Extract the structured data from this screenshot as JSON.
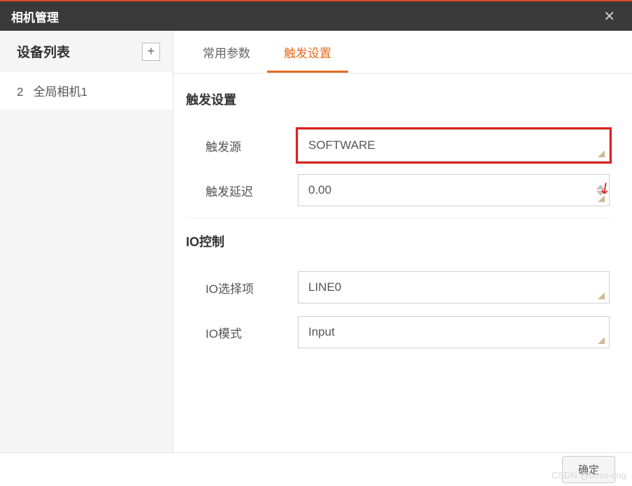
{
  "titlebar": {
    "title": "相机管理"
  },
  "sidebar": {
    "title": "设备列表",
    "add_label": "+",
    "items": [
      {
        "index": "2",
        "label": "全局相机1"
      }
    ]
  },
  "tabs": [
    {
      "label": "常用参数",
      "active": false
    },
    {
      "label": "触发设置",
      "active": true
    }
  ],
  "sections": {
    "trigger": {
      "title": "触发设置",
      "source_label": "触发源",
      "source_value": "SOFTWARE",
      "delay_label": "触发延迟",
      "delay_value": "0.00"
    },
    "io": {
      "title": "IO控制",
      "select_label": "IO选择项",
      "select_value": "LINE0",
      "mode_label": "IO模式",
      "mode_value": "Input"
    }
  },
  "footer": {
    "ok_label": "确定"
  },
  "watermark": "CSDN @boss-dog"
}
